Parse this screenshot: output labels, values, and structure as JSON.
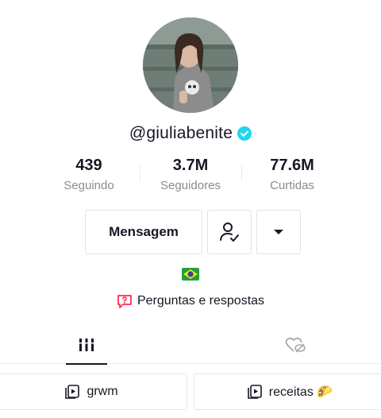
{
  "profile": {
    "handle": "@giuliabenite",
    "verified": true,
    "accent_color": "#20d5ec"
  },
  "stats": [
    {
      "value": "439",
      "label": "Seguindo"
    },
    {
      "value": "3.7M",
      "label": "Seguidores"
    },
    {
      "value": "77.6M",
      "label": "Curtidas"
    }
  ],
  "actions": {
    "message_label": "Mensagem",
    "following_icon": "person-check-icon",
    "more_icon": "caret-down-icon"
  },
  "bio": {
    "flag_icon": "brazil-flag-icon",
    "qa_label": "Perguntas e respostas",
    "qa_color": "#fe2c55"
  },
  "tabs": [
    {
      "icon": "grid-icon",
      "active": true
    },
    {
      "icon": "liked-hidden-icon",
      "active": false
    }
  ],
  "playlists": [
    {
      "label": "grwm",
      "icon": "playlist-icon"
    },
    {
      "label": "receitas 🌮",
      "icon": "playlist-icon"
    }
  ]
}
